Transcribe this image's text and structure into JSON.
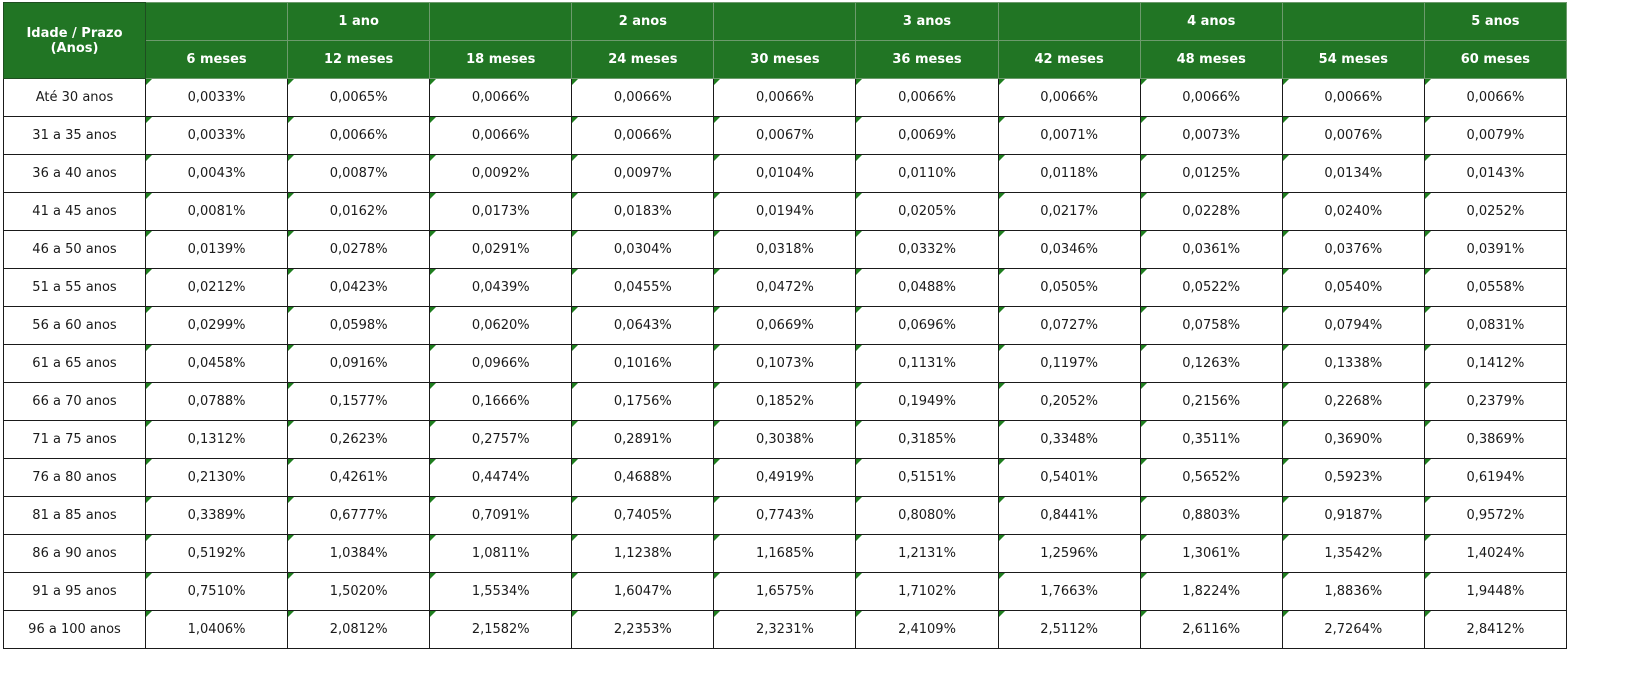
{
  "table": {
    "corner_label": "Idade / Prazo (Anos)",
    "year_headers": [
      "",
      "1 ano",
      "",
      "2 anos",
      "",
      "3 anos",
      "",
      "4 anos",
      "",
      "5 anos"
    ],
    "month_headers": [
      "6 meses",
      "12 meses",
      "18 meses",
      "24 meses",
      "30 meses",
      "36 meses",
      "42 meses",
      "48 meses",
      "54 meses",
      "60 meses"
    ],
    "rows": [
      {
        "age": "Até 30 anos",
        "values": [
          "0,0033%",
          "0,0065%",
          "0,0066%",
          "0,0066%",
          "0,0066%",
          "0,0066%",
          "0,0066%",
          "0,0066%",
          "0,0066%",
          "0,0066%"
        ]
      },
      {
        "age": "31 a 35 anos",
        "values": [
          "0,0033%",
          "0,0066%",
          "0,0066%",
          "0,0066%",
          "0,0067%",
          "0,0069%",
          "0,0071%",
          "0,0073%",
          "0,0076%",
          "0,0079%"
        ]
      },
      {
        "age": "36 a 40 anos",
        "values": [
          "0,0043%",
          "0,0087%",
          "0,0092%",
          "0,0097%",
          "0,0104%",
          "0,0110%",
          "0,0118%",
          "0,0125%",
          "0,0134%",
          "0,0143%"
        ]
      },
      {
        "age": "41 a 45 anos",
        "values": [
          "0,0081%",
          "0,0162%",
          "0,0173%",
          "0,0183%",
          "0,0194%",
          "0,0205%",
          "0,0217%",
          "0,0228%",
          "0,0240%",
          "0,0252%"
        ]
      },
      {
        "age": "46 a 50 anos",
        "values": [
          "0,0139%",
          "0,0278%",
          "0,0291%",
          "0,0304%",
          "0,0318%",
          "0,0332%",
          "0,0346%",
          "0,0361%",
          "0,0376%",
          "0,0391%"
        ]
      },
      {
        "age": "51 a 55 anos",
        "values": [
          "0,0212%",
          "0,0423%",
          "0,0439%",
          "0,0455%",
          "0,0472%",
          "0,0488%",
          "0,0505%",
          "0,0522%",
          "0,0540%",
          "0,0558%"
        ]
      },
      {
        "age": "56 a 60 anos",
        "values": [
          "0,0299%",
          "0,0598%",
          "0,0620%",
          "0,0643%",
          "0,0669%",
          "0,0696%",
          "0,0727%",
          "0,0758%",
          "0,0794%",
          "0,0831%"
        ]
      },
      {
        "age": "61 a 65 anos",
        "values": [
          "0,0458%",
          "0,0916%",
          "0,0966%",
          "0,1016%",
          "0,1073%",
          "0,1131%",
          "0,1197%",
          "0,1263%",
          "0,1338%",
          "0,1412%"
        ]
      },
      {
        "age": "66 a 70 anos",
        "values": [
          "0,0788%",
          "0,1577%",
          "0,1666%",
          "0,1756%",
          "0,1852%",
          "0,1949%",
          "0,2052%",
          "0,2156%",
          "0,2268%",
          "0,2379%"
        ]
      },
      {
        "age": "71 a 75 anos",
        "values": [
          "0,1312%",
          "0,2623%",
          "0,2757%",
          "0,2891%",
          "0,3038%",
          "0,3185%",
          "0,3348%",
          "0,3511%",
          "0,3690%",
          "0,3869%"
        ]
      },
      {
        "age": "76 a 80 anos",
        "values": [
          "0,2130%",
          "0,4261%",
          "0,4474%",
          "0,4688%",
          "0,4919%",
          "0,5151%",
          "0,5401%",
          "0,5652%",
          "0,5923%",
          "0,6194%"
        ]
      },
      {
        "age": "81 a 85 anos",
        "values": [
          "0,3389%",
          "0,6777%",
          "0,7091%",
          "0,7405%",
          "0,7743%",
          "0,8080%",
          "0,8441%",
          "0,8803%",
          "0,9187%",
          "0,9572%"
        ]
      },
      {
        "age": "86 a 90 anos",
        "values": [
          "0,5192%",
          "1,0384%",
          "1,0811%",
          "1,1238%",
          "1,1685%",
          "1,2131%",
          "1,2596%",
          "1,3061%",
          "1,3542%",
          "1,4024%"
        ]
      },
      {
        "age": "91 a 95 anos",
        "values": [
          "0,7510%",
          "1,5020%",
          "1,5534%",
          "1,6047%",
          "1,6575%",
          "1,7102%",
          "1,7663%",
          "1,8224%",
          "1,8836%",
          "1,9448%"
        ]
      },
      {
        "age": "96 a 100 anos",
        "values": [
          "1,0406%",
          "2,0812%",
          "2,1582%",
          "2,2353%",
          "2,3231%",
          "2,4109%",
          "2,5112%",
          "2,6116%",
          "2,7264%",
          "2,8412%"
        ]
      }
    ]
  },
  "colors": {
    "header_background": "#217524",
    "header_text": "#ffffff",
    "cell_border": "#1a1a1a",
    "cell_marker": "#1e7e1e"
  }
}
